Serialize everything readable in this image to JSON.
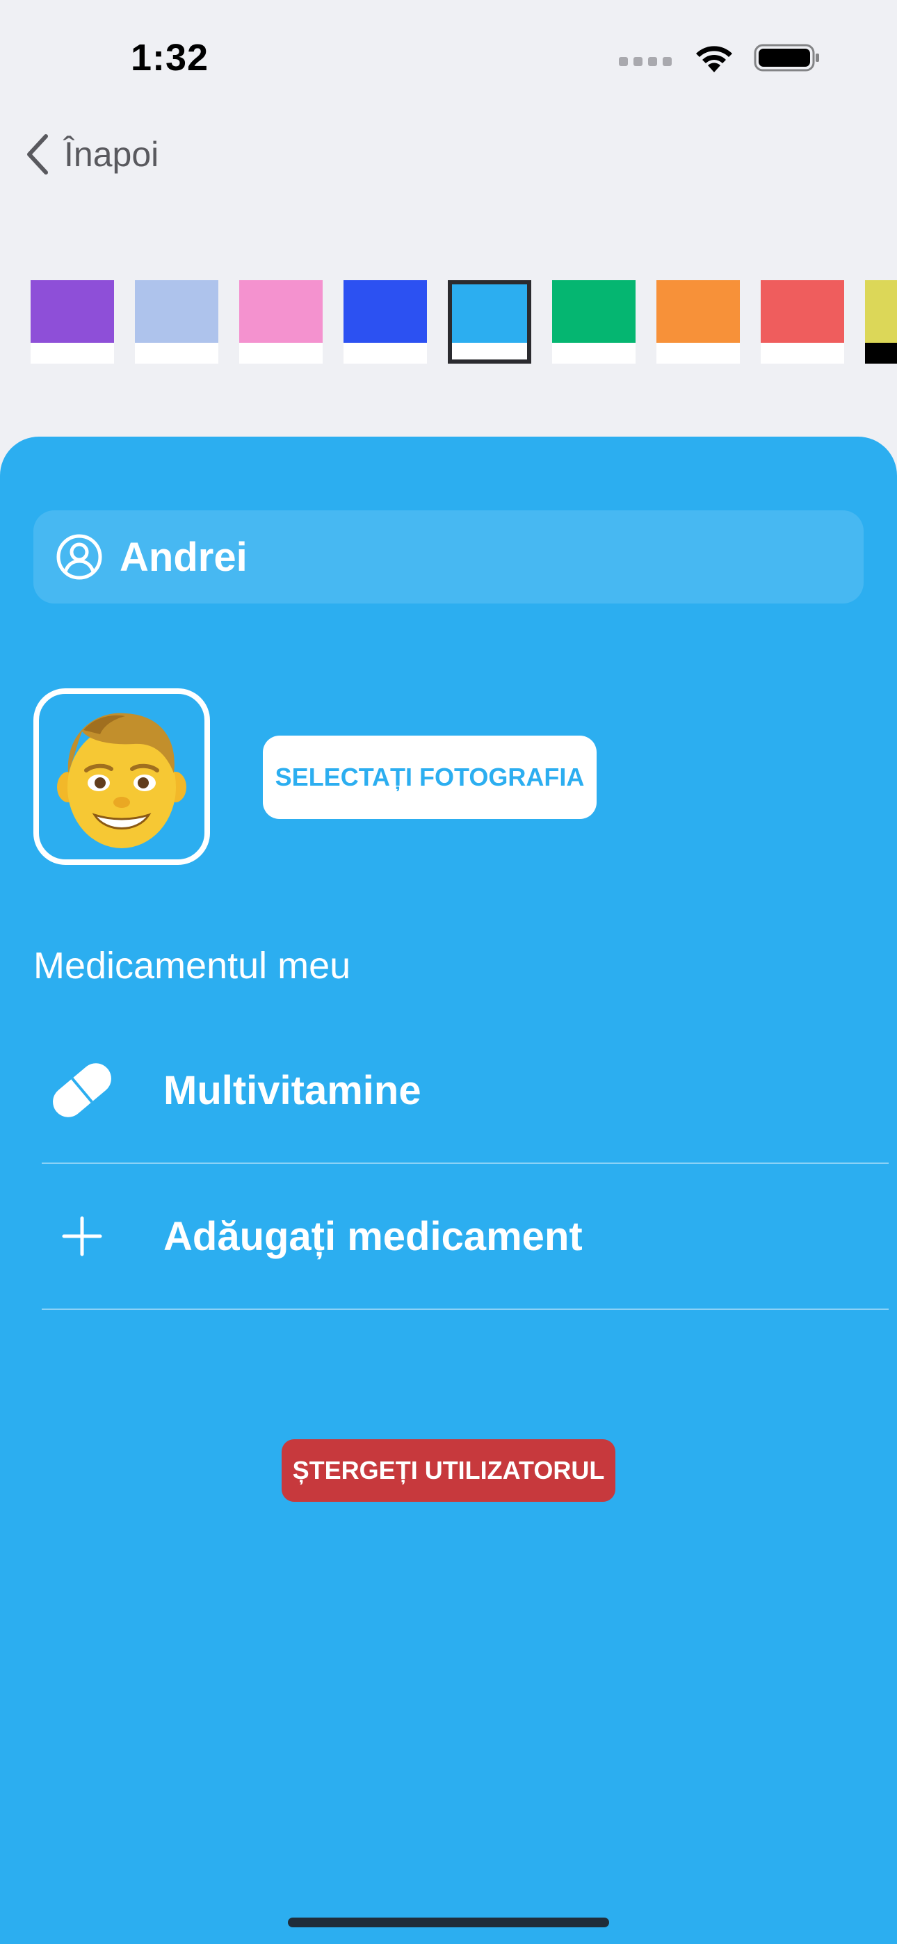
{
  "status_bar": {
    "time": "1:32"
  },
  "nav": {
    "back_label": "Înapoi"
  },
  "swatches": [
    {
      "color": "#8e4fd8",
      "selected": false
    },
    {
      "color": "#aec3ec",
      "selected": false
    },
    {
      "color": "#f492cf",
      "selected": false
    },
    {
      "color": "#2c51f2",
      "selected": false
    },
    {
      "color": "#2caef0",
      "selected": true
    },
    {
      "color": "#05b671",
      "selected": false
    },
    {
      "color": "#f79139",
      "selected": false
    },
    {
      "color": "#ef5d5d",
      "selected": false
    },
    {
      "color": "#dcd758",
      "selected": false
    }
  ],
  "colors": {
    "card_background": "#2caef0",
    "delete_button": "#c7393d",
    "page_background": "#eff0f4"
  },
  "profile": {
    "name": "Andrei",
    "select_photo_label": "SELECTAȚI FOTOGRAFIA"
  },
  "medications": {
    "section_title": "Medicamentul meu",
    "items": [
      {
        "label": "Multivitamine",
        "icon": "pill-icon"
      }
    ],
    "add_label": "Adăugați medicament"
  },
  "actions": {
    "delete_user_label": "ȘTERGEȚI UTILIZATORUL"
  }
}
